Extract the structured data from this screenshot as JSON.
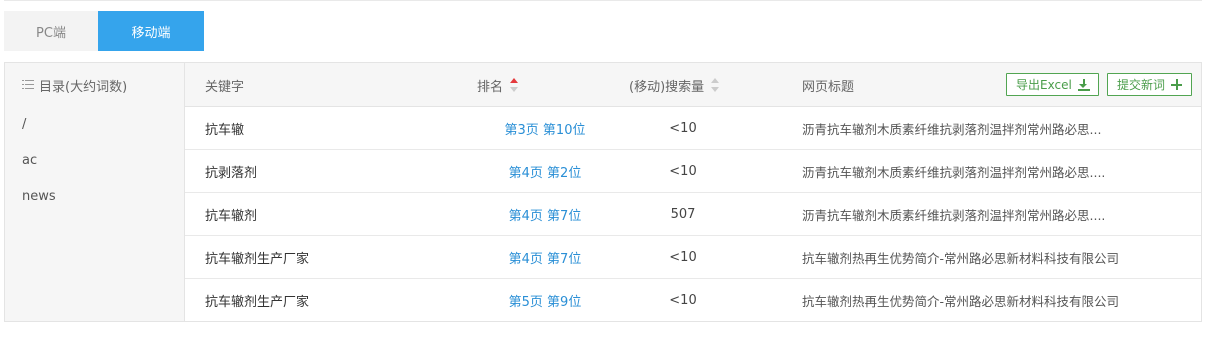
{
  "tabs": [
    {
      "label": "PC端",
      "active": false
    },
    {
      "label": "移动端",
      "active": true
    }
  ],
  "sidebar": {
    "header": "目录(大约词数)",
    "items": [
      "/",
      "ac",
      "news"
    ]
  },
  "table": {
    "headers": {
      "keyword": "关键字",
      "rank": "排名",
      "volume": "(移动)搜索量",
      "title": "网页标题"
    },
    "export_button": "导出Excel",
    "add_button": "提交新词",
    "rows": [
      {
        "keyword": "抗车辙",
        "rank": "第3页 第10位",
        "volume": "<10",
        "title": "沥青抗车辙剂木质素纤维抗剥落剂温拌剂常州路必思..."
      },
      {
        "keyword": "抗剥落剂",
        "rank": "第4页 第2位",
        "volume": "<10",
        "title": "沥青抗车辙剂木质素纤维抗剥落剂温拌剂常州路必思...."
      },
      {
        "keyword": "抗车辙剂",
        "rank": "第4页 第7位",
        "volume": "507",
        "title": "沥青抗车辙剂木质素纤维抗剥落剂温拌剂常州路必思...."
      },
      {
        "keyword": "抗车辙剂生产厂家",
        "rank": "第4页 第7位",
        "volume": "<10",
        "title": "抗车辙剂热再生优势简介-常州路必思新材料科技有限公司"
      },
      {
        "keyword": "抗车辙剂生产厂家",
        "rank": "第5页 第9位",
        "volume": "<10",
        "title": "抗车辙剂热再生优势简介-常州路必思新材料科技有限公司"
      }
    ]
  },
  "colors": {
    "active_tab": "#35a4ec",
    "link": "#2a8fd6",
    "button_green": "#4a9d4a",
    "sort_active": "#e4393c"
  }
}
